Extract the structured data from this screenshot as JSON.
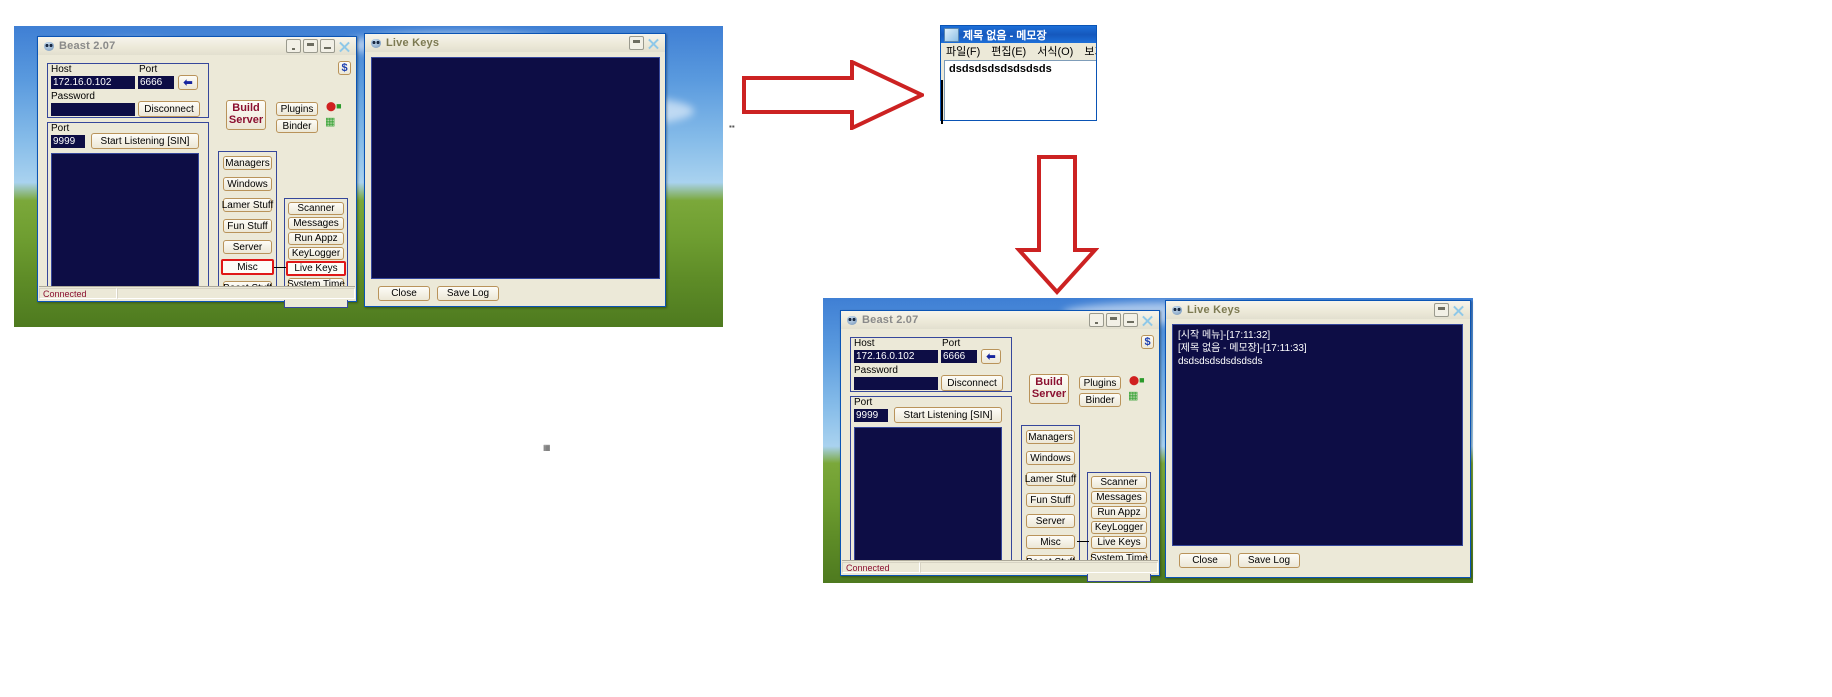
{
  "beast_top": {
    "title": "Beast 2.07",
    "icon": "alien-icon",
    "titlebar_buttons": [
      "minimize-to-tray",
      "minimize",
      "restore",
      "close"
    ],
    "connection_group": {
      "host_label": "Host",
      "host_value": "172.16.0.102",
      "port_label": "Port",
      "port_value": "6666",
      "password_label": "Password",
      "password_value": "",
      "disconnect_label": "Disconnect",
      "go_arrow_icon": "down-left-arrow-icon"
    },
    "listen_group": {
      "port_label": "Port",
      "port_value": "9999",
      "start_listening_label": "Start Listening [SIN]"
    },
    "build_server_label_line1": "Build",
    "build_server_label_line2": "Server",
    "plugins_label": "Plugins",
    "binder_label": "Binder",
    "dollar_icon": "dollar-icon",
    "net_icon_1": "connection-icon",
    "net_icon_2": "network-graph-icon",
    "menu_column": [
      "Managers",
      "Windows",
      "Lamer Stuff",
      "Fun Stuff",
      "Server",
      "Misc",
      "Beast Stuff"
    ],
    "menu_column_highlight": "Misc",
    "sub_column": [
      "Scanner",
      "Messages",
      "Run Appz",
      "KeyLogger",
      "Live Keys",
      "System Time"
    ],
    "sub_column_highlight": "Live Keys",
    "status": "Connected"
  },
  "livekeys_top": {
    "title": "Live Keys",
    "icon": "alien-icon",
    "titlebar_buttons": [
      "minimize",
      "close"
    ],
    "log_lines": [],
    "close_label": "Close",
    "save_log_label": "Save Log"
  },
  "notepad": {
    "title": "제목 없음 - 메모장",
    "icon": "notepad-icon",
    "menu": [
      "파일(F)",
      "편집(E)",
      "서식(O)",
      "보기(V"
    ],
    "content": "dsdsdsdsdsdsdsds"
  },
  "beast_bottom": {
    "title": "Beast 2.07",
    "icon": "alien-icon",
    "titlebar_buttons": [
      "minimize-to-tray",
      "minimize",
      "restore",
      "close"
    ],
    "connection_group": {
      "host_label": "Host",
      "host_value": "172.16.0.102",
      "port_label": "Port",
      "port_value": "6666",
      "password_label": "Password",
      "password_value": "",
      "disconnect_label": "Disconnect",
      "go_arrow_icon": "down-left-arrow-icon"
    },
    "listen_group": {
      "port_label": "Port",
      "port_value": "9999",
      "start_listening_label": "Start Listening [SIN]"
    },
    "build_server_label_line1": "Build",
    "build_server_label_line2": "Server",
    "plugins_label": "Plugins",
    "binder_label": "Binder",
    "dollar_icon": "dollar-icon",
    "net_icon_1": "connection-icon",
    "net_icon_2": "network-graph-icon",
    "menu_column": [
      "Managers",
      "Windows",
      "Lamer Stuff",
      "Fun Stuff",
      "Server",
      "Misc",
      "Beast Stuff"
    ],
    "sub_column": [
      "Scanner",
      "Messages",
      "Run Appz",
      "KeyLogger",
      "Live Keys",
      "System Time"
    ],
    "sub_column_highlight": "Live Keys",
    "status": "Connected"
  },
  "livekeys_bottom": {
    "title": "Live Keys",
    "icon": "alien-icon",
    "titlebar_buttons": [
      "minimize",
      "close"
    ],
    "log_lines": [
      "[시작 메뉴]-[17:11:32]",
      "",
      "",
      "[제목 없음 - 메모장]-[17:11:33]",
      "dsdsdsdsdsdsdsds"
    ],
    "close_label": "Close",
    "save_log_label": "Save Log"
  },
  "annotations": {
    "arrow_right_color": "#cc2222",
    "arrow_down_color": "#cc2222",
    "highlight_color": "#e01717"
  }
}
